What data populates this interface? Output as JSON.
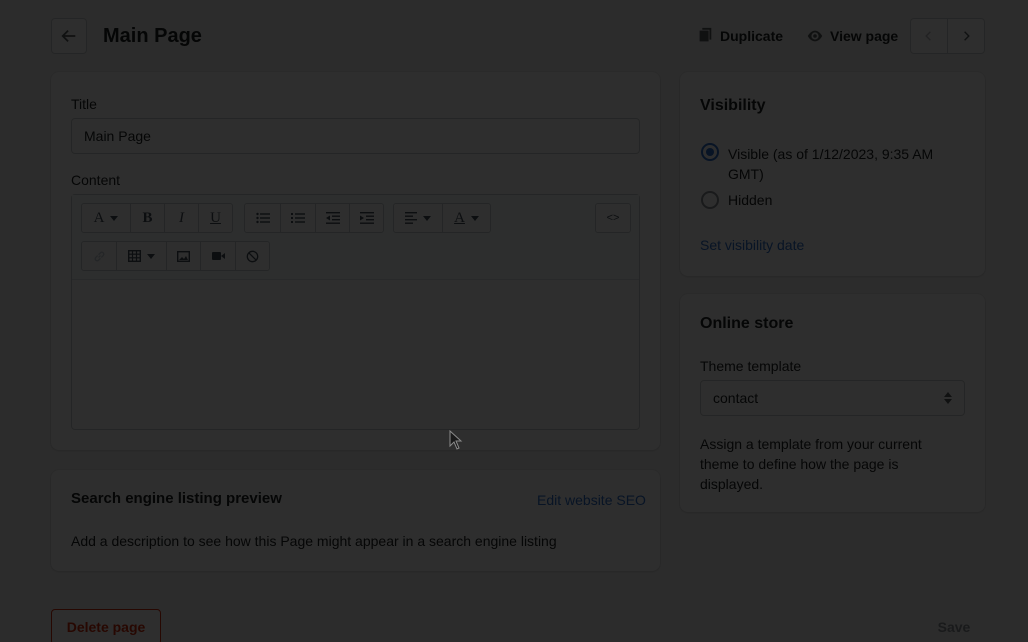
{
  "header": {
    "title": "Main Page",
    "duplicate_label": "Duplicate",
    "view_label": "View page"
  },
  "main": {
    "title_label": "Title",
    "title_value": "Main Page",
    "content_label": "Content",
    "toolbar": {
      "font_label": "A",
      "bold_label": "B",
      "italic_label": "I",
      "underline_label": "U",
      "color_label": "A",
      "html_label": "<>"
    }
  },
  "seo": {
    "title": "Search engine listing preview",
    "edit_link": "Edit website SEO",
    "description": "Add a description to see how this Page might appear in a search engine listing"
  },
  "visibility": {
    "title": "Visibility",
    "visible_label": "Visible (as of 1/12/2023, 9:35 AM GMT)",
    "hidden_label": "Hidden",
    "set_date_link": "Set visibility date",
    "selected": "visible"
  },
  "online_store": {
    "title": "Online store",
    "template_label": "Theme template",
    "template_value": "contact",
    "help_text": "Assign a template from your current theme to define how the page is displayed."
  },
  "footer": {
    "delete_label": "Delete page",
    "save_label": "Save"
  },
  "colors": {
    "accent": "#2c6ecb",
    "critical": "#d72c0d",
    "overlay": "#000000"
  }
}
